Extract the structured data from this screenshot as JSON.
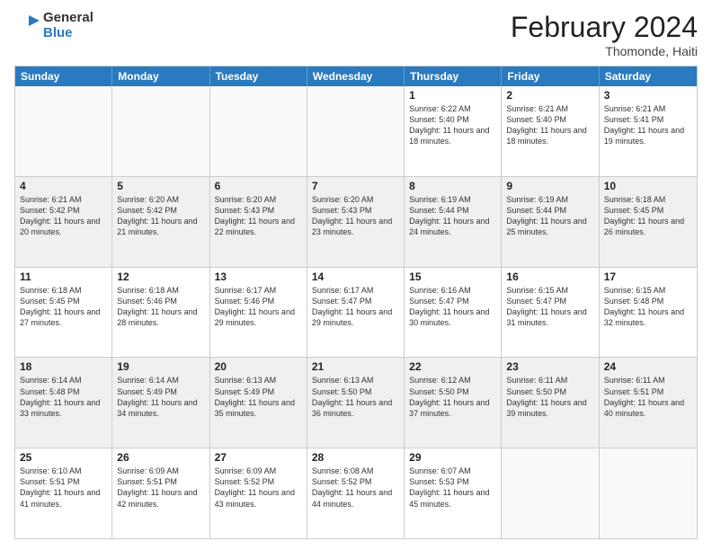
{
  "header": {
    "logo_general": "General",
    "logo_blue": "Blue",
    "month_year": "February 2024",
    "location": "Thomonde, Haiti"
  },
  "day_headers": [
    "Sunday",
    "Monday",
    "Tuesday",
    "Wednesday",
    "Thursday",
    "Friday",
    "Saturday"
  ],
  "weeks": [
    {
      "alt": false,
      "days": [
        {
          "date": "",
          "info": ""
        },
        {
          "date": "",
          "info": ""
        },
        {
          "date": "",
          "info": ""
        },
        {
          "date": "",
          "info": ""
        },
        {
          "date": "1",
          "info": "Sunrise: 6:22 AM\nSunset: 5:40 PM\nDaylight: 11 hours and 18 minutes."
        },
        {
          "date": "2",
          "info": "Sunrise: 6:21 AM\nSunset: 5:40 PM\nDaylight: 11 hours and 18 minutes."
        },
        {
          "date": "3",
          "info": "Sunrise: 6:21 AM\nSunset: 5:41 PM\nDaylight: 11 hours and 19 minutes."
        }
      ]
    },
    {
      "alt": true,
      "days": [
        {
          "date": "4",
          "info": "Sunrise: 6:21 AM\nSunset: 5:42 PM\nDaylight: 11 hours and 20 minutes."
        },
        {
          "date": "5",
          "info": "Sunrise: 6:20 AM\nSunset: 5:42 PM\nDaylight: 11 hours and 21 minutes."
        },
        {
          "date": "6",
          "info": "Sunrise: 6:20 AM\nSunset: 5:43 PM\nDaylight: 11 hours and 22 minutes."
        },
        {
          "date": "7",
          "info": "Sunrise: 6:20 AM\nSunset: 5:43 PM\nDaylight: 11 hours and 23 minutes."
        },
        {
          "date": "8",
          "info": "Sunrise: 6:19 AM\nSunset: 5:44 PM\nDaylight: 11 hours and 24 minutes."
        },
        {
          "date": "9",
          "info": "Sunrise: 6:19 AM\nSunset: 5:44 PM\nDaylight: 11 hours and 25 minutes."
        },
        {
          "date": "10",
          "info": "Sunrise: 6:18 AM\nSunset: 5:45 PM\nDaylight: 11 hours and 26 minutes."
        }
      ]
    },
    {
      "alt": false,
      "days": [
        {
          "date": "11",
          "info": "Sunrise: 6:18 AM\nSunset: 5:45 PM\nDaylight: 11 hours and 27 minutes."
        },
        {
          "date": "12",
          "info": "Sunrise: 6:18 AM\nSunset: 5:46 PM\nDaylight: 11 hours and 28 minutes."
        },
        {
          "date": "13",
          "info": "Sunrise: 6:17 AM\nSunset: 5:46 PM\nDaylight: 11 hours and 29 minutes."
        },
        {
          "date": "14",
          "info": "Sunrise: 6:17 AM\nSunset: 5:47 PM\nDaylight: 11 hours and 29 minutes."
        },
        {
          "date": "15",
          "info": "Sunrise: 6:16 AM\nSunset: 5:47 PM\nDaylight: 11 hours and 30 minutes."
        },
        {
          "date": "16",
          "info": "Sunrise: 6:15 AM\nSunset: 5:47 PM\nDaylight: 11 hours and 31 minutes."
        },
        {
          "date": "17",
          "info": "Sunrise: 6:15 AM\nSunset: 5:48 PM\nDaylight: 11 hours and 32 minutes."
        }
      ]
    },
    {
      "alt": true,
      "days": [
        {
          "date": "18",
          "info": "Sunrise: 6:14 AM\nSunset: 5:48 PM\nDaylight: 11 hours and 33 minutes."
        },
        {
          "date": "19",
          "info": "Sunrise: 6:14 AM\nSunset: 5:49 PM\nDaylight: 11 hours and 34 minutes."
        },
        {
          "date": "20",
          "info": "Sunrise: 6:13 AM\nSunset: 5:49 PM\nDaylight: 11 hours and 35 minutes."
        },
        {
          "date": "21",
          "info": "Sunrise: 6:13 AM\nSunset: 5:50 PM\nDaylight: 11 hours and 36 minutes."
        },
        {
          "date": "22",
          "info": "Sunrise: 6:12 AM\nSunset: 5:50 PM\nDaylight: 11 hours and 37 minutes."
        },
        {
          "date": "23",
          "info": "Sunrise: 6:11 AM\nSunset: 5:50 PM\nDaylight: 11 hours and 39 minutes."
        },
        {
          "date": "24",
          "info": "Sunrise: 6:11 AM\nSunset: 5:51 PM\nDaylight: 11 hours and 40 minutes."
        }
      ]
    },
    {
      "alt": false,
      "days": [
        {
          "date": "25",
          "info": "Sunrise: 6:10 AM\nSunset: 5:51 PM\nDaylight: 11 hours and 41 minutes."
        },
        {
          "date": "26",
          "info": "Sunrise: 6:09 AM\nSunset: 5:51 PM\nDaylight: 11 hours and 42 minutes."
        },
        {
          "date": "27",
          "info": "Sunrise: 6:09 AM\nSunset: 5:52 PM\nDaylight: 11 hours and 43 minutes."
        },
        {
          "date": "28",
          "info": "Sunrise: 6:08 AM\nSunset: 5:52 PM\nDaylight: 11 hours and 44 minutes."
        },
        {
          "date": "29",
          "info": "Sunrise: 6:07 AM\nSunset: 5:53 PM\nDaylight: 11 hours and 45 minutes."
        },
        {
          "date": "",
          "info": ""
        },
        {
          "date": "",
          "info": ""
        }
      ]
    }
  ]
}
